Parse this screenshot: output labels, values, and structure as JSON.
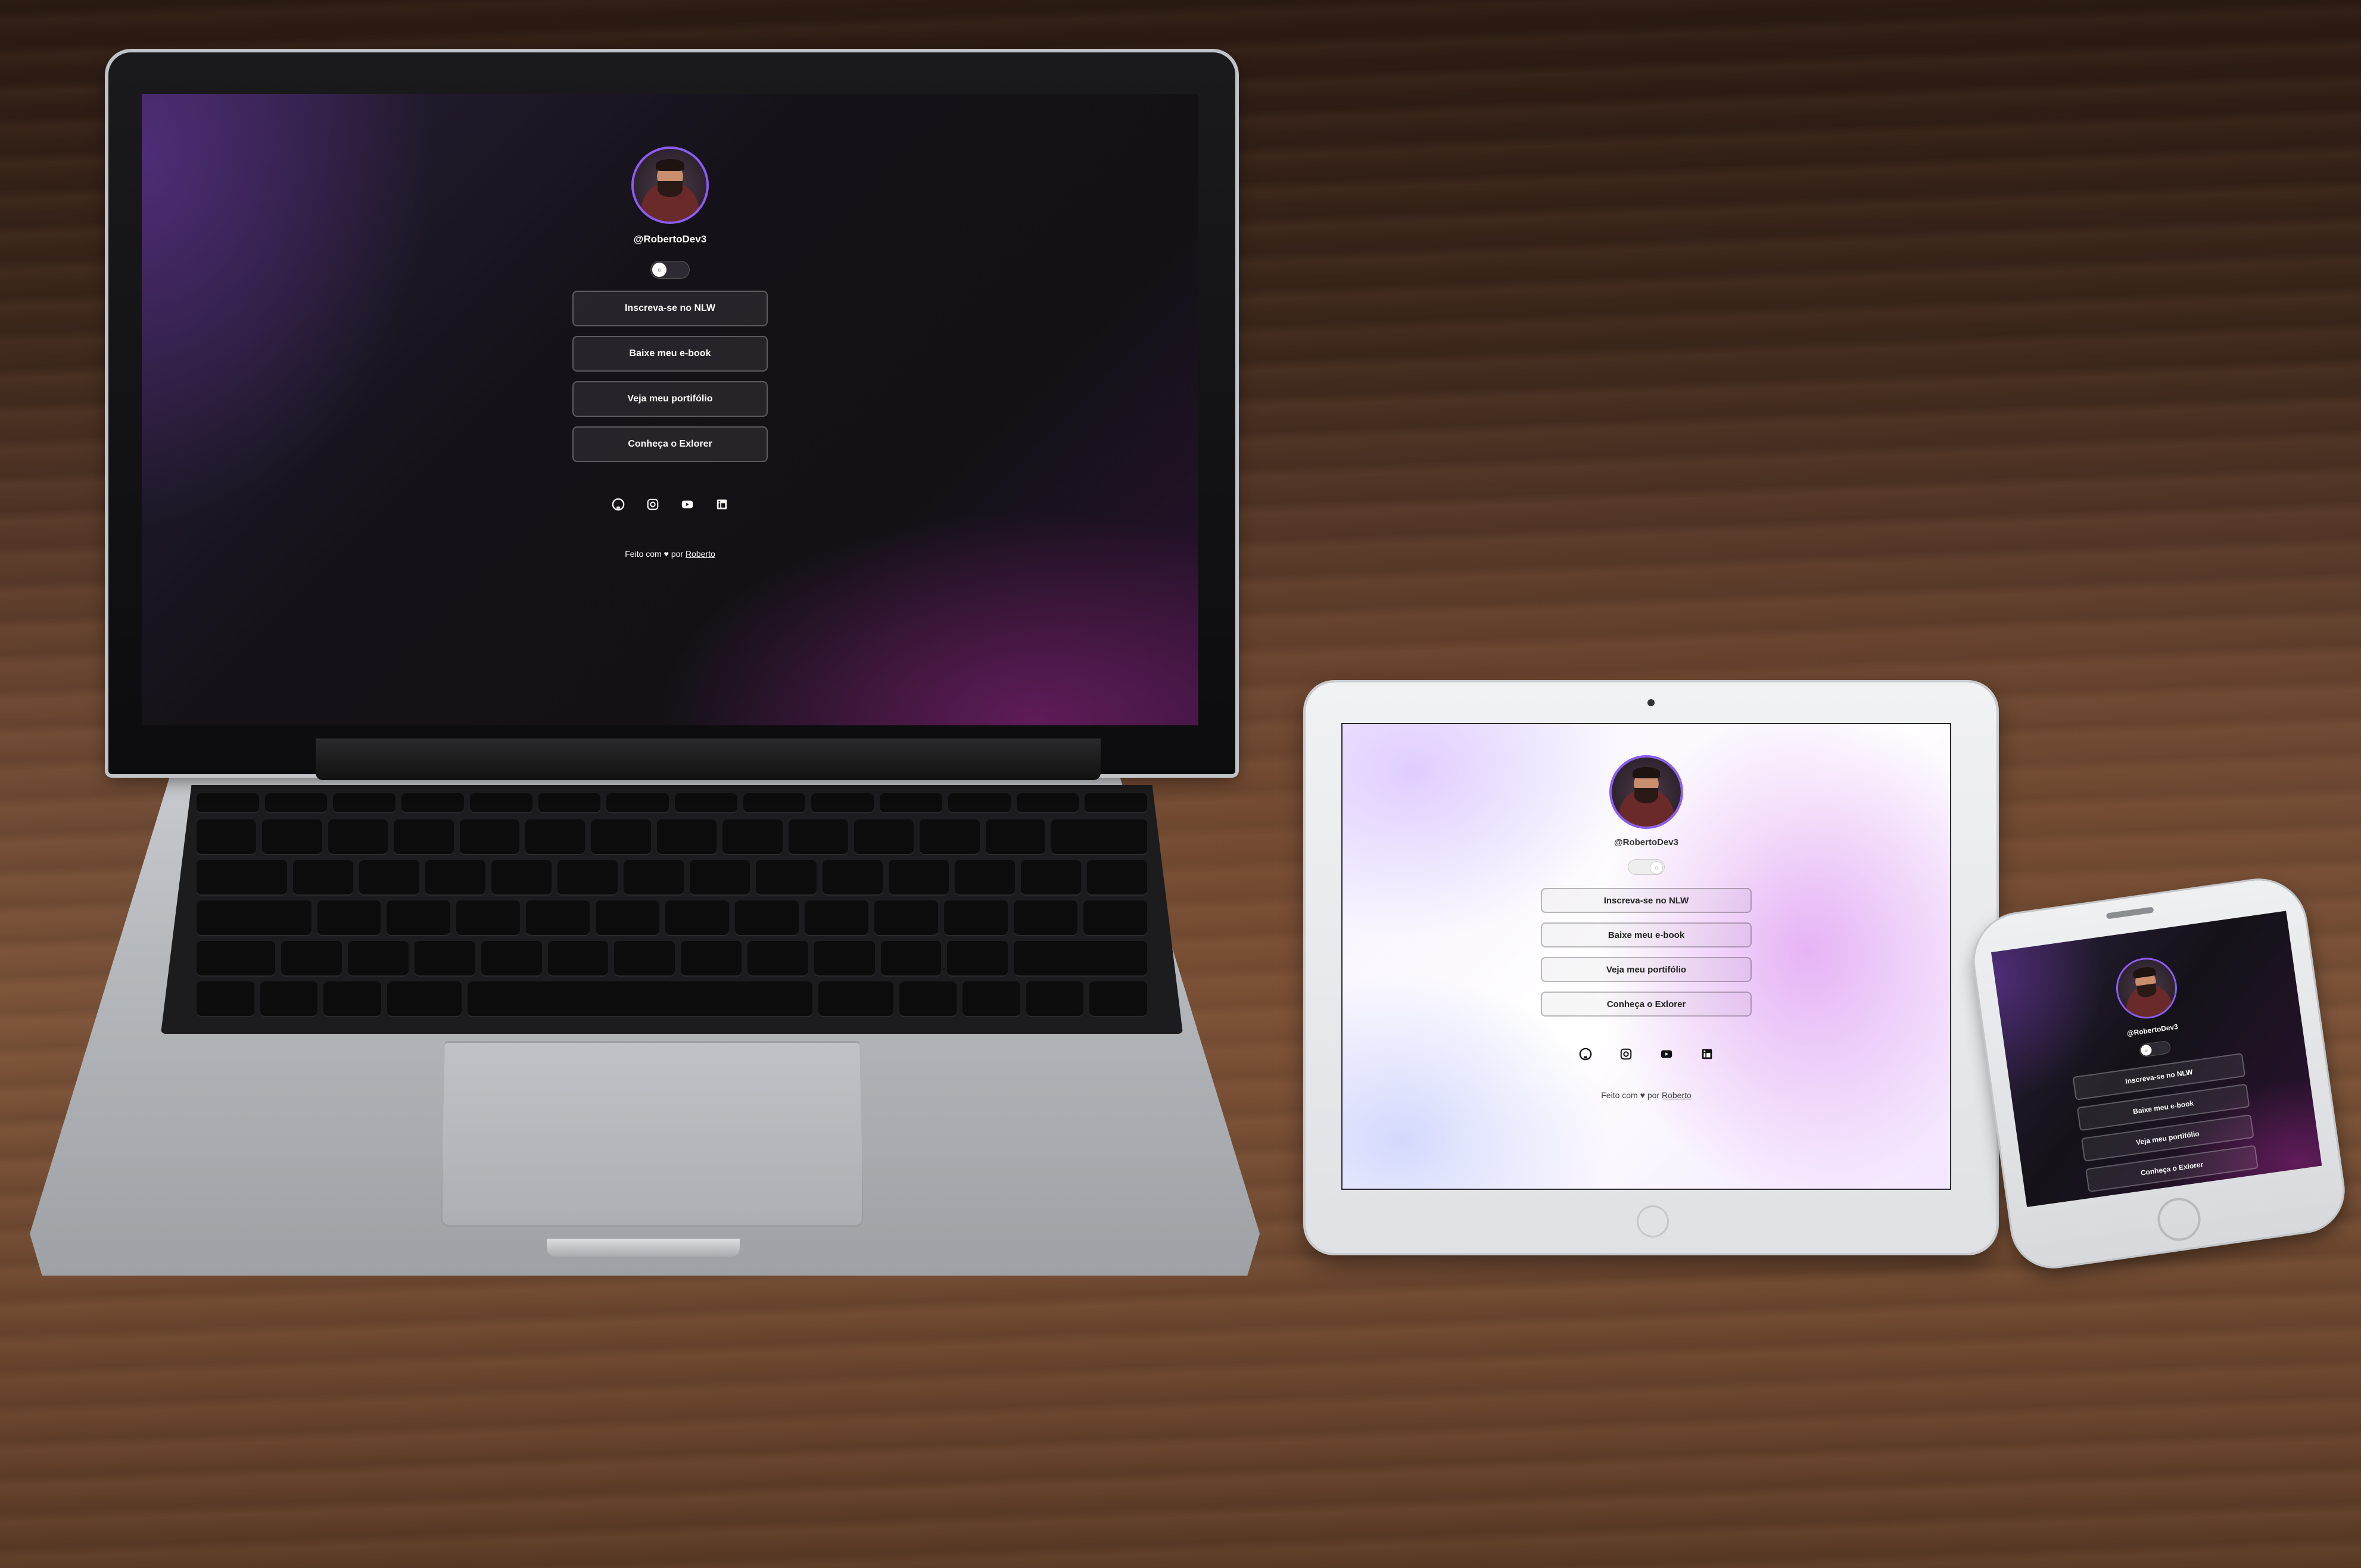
{
  "profile": {
    "username": "@RobertoDev3",
    "theme_toggle_icon": "sun-icon",
    "buttons": [
      "Inscreva-se no NLW",
      "Baixe meu e-book",
      "Veja meu portifólio",
      "Conheça o Exlorer"
    ],
    "socials": [
      "github-icon",
      "instagram-icon",
      "youtube-icon",
      "linkedin-icon"
    ],
    "footer": {
      "prefix": "Feito com",
      "heart": "♥",
      "by": "por",
      "author": "Roberto"
    }
  },
  "colors": {
    "dark_bg": "#141218",
    "light_bg": "#ffffff",
    "accent": "#8b5cf6"
  }
}
